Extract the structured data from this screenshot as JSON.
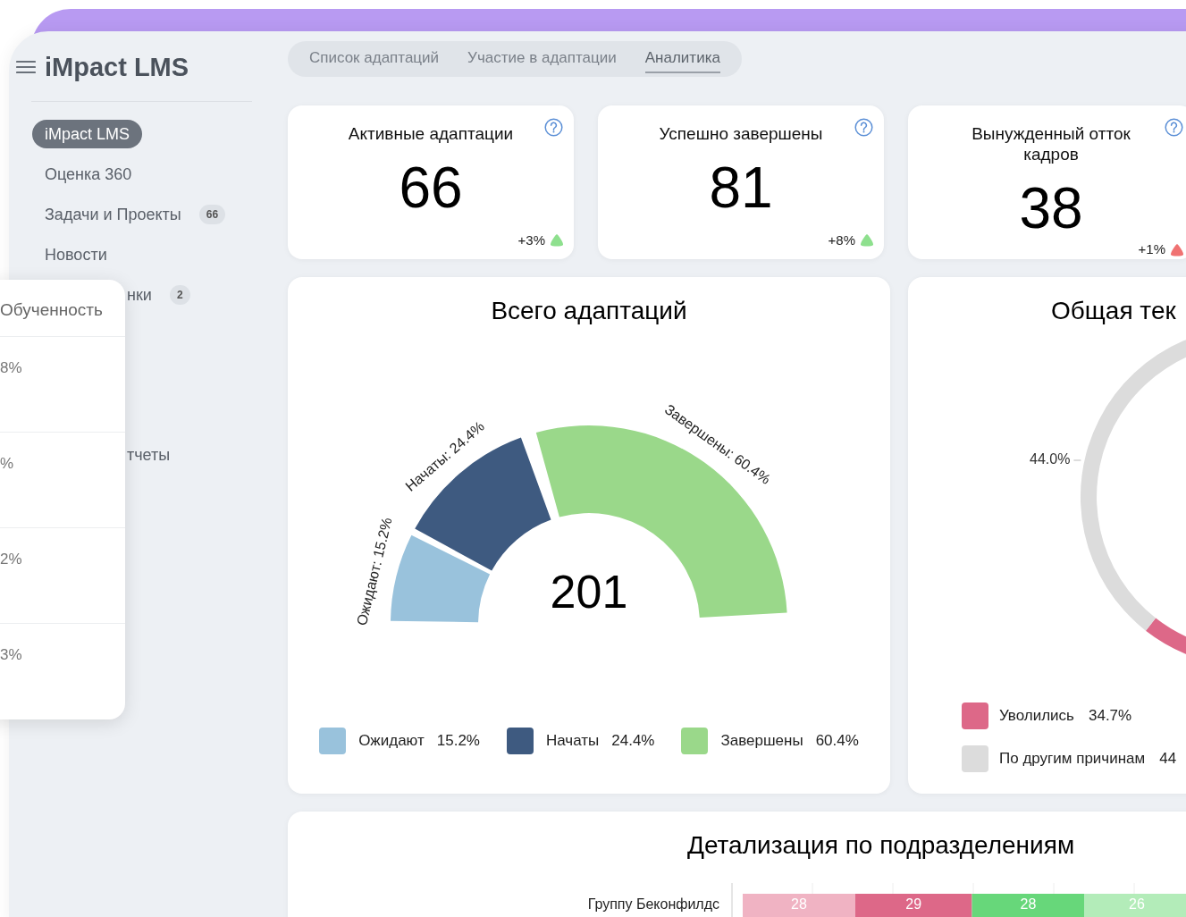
{
  "sidebar": {
    "title": "iMpact LMS",
    "items": [
      {
        "kind": "item",
        "label": "iMpact LMS",
        "selected": true
      },
      {
        "kind": "item",
        "label": "Оценка 360",
        "selected": false
      },
      {
        "kind": "item",
        "label": "Задачи и Проекты",
        "badge": "66",
        "selected": false
      },
      {
        "kind": "item",
        "label": "Новости",
        "selected": false
      },
      {
        "kind": "clipped",
        "label": "нки",
        "badge": "2",
        "selected": false
      },
      {
        "kind": "clipped",
        "label": "тчеты",
        "selected": false
      }
    ]
  },
  "overlay_card": {
    "title": "Обученность",
    "rows": [
      "8%",
      "%",
      "2%",
      "3%"
    ]
  },
  "tabs": [
    {
      "label": "Список адаптаций",
      "selected": false
    },
    {
      "label": "Участие в адаптации",
      "selected": false
    },
    {
      "label": "Аналитика",
      "selected": true
    }
  ],
  "kpis": [
    {
      "title": "Активные адаптации",
      "value": "66",
      "change": "+3%",
      "color": "#8ee08e"
    },
    {
      "title": "Успешно завершены",
      "value": "81",
      "change": "+8%",
      "color": "#8ee08e"
    },
    {
      "title": "Вынужденный отток кадров",
      "value": "38",
      "change": "+1%",
      "color": "#f07272"
    }
  ],
  "adaptations_card": {
    "title": "Всего адаптаций",
    "total": "201",
    "chart_data": {
      "type": "donut",
      "categories": [
        "Ожидают",
        "Начаты",
        "Завершены"
      ],
      "values": [
        15.2,
        24.4,
        60.4
      ],
      "colors": [
        "#99c2dc",
        "#3e5a80",
        "#9ad88a"
      ],
      "value_labels": [
        "Ожидают: 15.2%",
        "Начаты: 24.4%",
        "Завершены: 60.4%"
      ]
    },
    "legend": [
      {
        "value": "15.2%"
      },
      {
        "value": "24.4%"
      },
      {
        "value": "60.4%"
      }
    ]
  },
  "turnover_card": {
    "title": "Общая тек",
    "chart_data": {
      "type": "donut",
      "categories": [
        "Уволились",
        "По другим причинам"
      ],
      "values": [
        34.7,
        44.0
      ],
      "colors": [
        "#dd6888",
        "#dcdcdc"
      ],
      "value_labels": [
        null,
        "44.0%"
      ]
    },
    "legend": [
      {
        "value": "34.7%"
      },
      {
        "value": "44"
      }
    ]
  },
  "departments_card": {
    "title": "Детализация по подразделениям",
    "chart_data": {
      "type": "bar",
      "orientation": "horizontal",
      "stacked": true,
      "categories": [
        "Группу Беконфилдс"
      ],
      "data_labels": true,
      "series": [
        {
          "color": "#f0b3c3",
          "values": [
            28
          ]
        },
        {
          "color": "#dd6888",
          "values": [
            29
          ]
        },
        {
          "color": "#67d77a",
          "values": [
            28
          ]
        },
        {
          "color": "#b3ecb9",
          "values": [
            26
          ]
        }
      ]
    }
  }
}
